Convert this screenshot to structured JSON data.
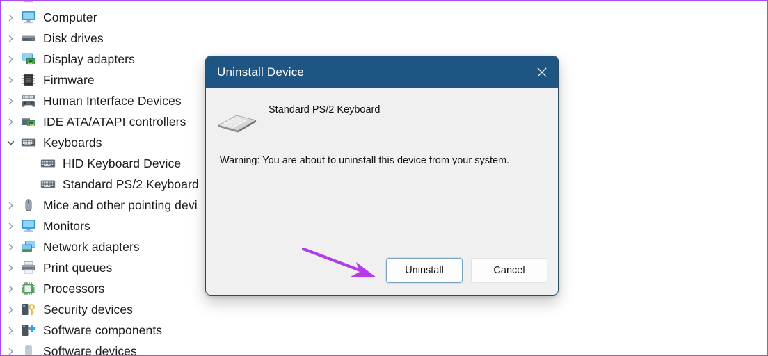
{
  "annotation": {
    "frame_color": "#b14aee",
    "arrow_color": "#b33ce8",
    "arrow_name": "callout-arrow-to-uninstall"
  },
  "tree": {
    "name": "device-manager-tree",
    "rows": [
      {
        "label": "",
        "icon": "monitor-icon",
        "expander": "collapsed",
        "level": 0,
        "partial": true
      },
      {
        "label": "Computer",
        "icon": "monitor-icon",
        "expander": "collapsed",
        "level": 0
      },
      {
        "label": "Disk drives",
        "icon": "disk-drive-icon",
        "expander": "collapsed",
        "level": 0
      },
      {
        "label": "Display adapters",
        "icon": "display-adapter-icon",
        "expander": "collapsed",
        "level": 0
      },
      {
        "label": "Firmware",
        "icon": "firmware-chip-icon",
        "expander": "collapsed",
        "level": 0
      },
      {
        "label": "Human Interface Devices",
        "icon": "hid-gamepad-icon",
        "expander": "collapsed",
        "level": 0
      },
      {
        "label": "IDE ATA/ATAPI controllers",
        "icon": "ide-controller-icon",
        "expander": "collapsed",
        "level": 0
      },
      {
        "label": "Keyboards",
        "icon": "keyboard-icon",
        "expander": "expanded",
        "level": 0
      },
      {
        "label": "HID Keyboard Device",
        "icon": "keyboard-icon",
        "expander": "none",
        "level": 1
      },
      {
        "label": "Standard PS/2 Keyboard",
        "icon": "keyboard-icon",
        "expander": "none",
        "level": 1
      },
      {
        "label": "Mice and other pointing devi",
        "icon": "mouse-icon",
        "expander": "collapsed",
        "level": 0
      },
      {
        "label": "Monitors",
        "icon": "monitor-icon",
        "expander": "collapsed",
        "level": 0
      },
      {
        "label": "Network adapters",
        "icon": "network-adapter-icon",
        "expander": "collapsed",
        "level": 0
      },
      {
        "label": "Print queues",
        "icon": "printer-icon",
        "expander": "collapsed",
        "level": 0
      },
      {
        "label": "Processors",
        "icon": "processor-icon",
        "expander": "collapsed",
        "level": 0
      },
      {
        "label": "Security devices",
        "icon": "security-device-icon",
        "expander": "collapsed",
        "level": 0
      },
      {
        "label": "Software components",
        "icon": "software-component-icon",
        "expander": "collapsed",
        "level": 0
      },
      {
        "label": "Software devices",
        "icon": "software-device-icon",
        "expander": "collapsed",
        "level": 0
      }
    ]
  },
  "dialog": {
    "title": "Uninstall Device",
    "close_label": "✕",
    "titlebar_color": "#1f5582",
    "body_color": "#f0f0f0",
    "device_name": "Standard PS/2 Keyboard",
    "device_icon": "keyboard-3d-icon",
    "warning": "Warning: You are about to uninstall this device from your system.",
    "buttons": {
      "primary": "Uninstall",
      "secondary": "Cancel"
    }
  }
}
